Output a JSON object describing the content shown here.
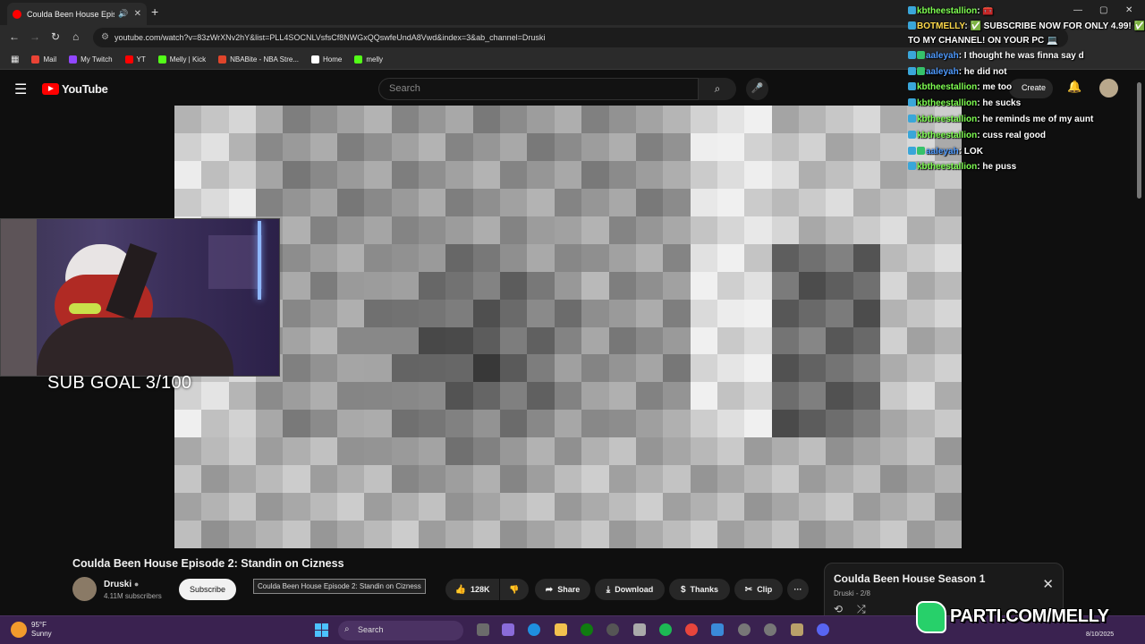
{
  "browser": {
    "tab_title": "Coulda Been House Episo",
    "url": "youtube.com/watch?v=83zWrXNv2hY&list=PLL4SOCNLVsfsCf8NWGxQQswfeUndA8Vwd&index=3&ab_channel=Druski",
    "bookmarks": [
      {
        "label": "Mail",
        "color": "#ea4335"
      },
      {
        "label": "My Twitch",
        "color": "#9146ff"
      },
      {
        "label": "YT",
        "color": "#ff0000"
      },
      {
        "label": "Melly | Kick",
        "color": "#53fc18"
      },
      {
        "label": "NBABite - NBA Stre...",
        "color": "#e0452b"
      },
      {
        "label": "Home",
        "color": "#ffffff"
      },
      {
        "label": "melly",
        "color": "#53fc18"
      }
    ]
  },
  "youtube": {
    "logo": "YouTube",
    "search_placeholder": "Search",
    "create_label": "Create"
  },
  "overlay": {
    "sub_goal": "SUB GOAL 3/100"
  },
  "video": {
    "title": "Coulda Been House Episode 2: Standin on Cizness",
    "tooltip": "Coulda Been House Episode 2: Standin on Cizness",
    "channel": "Druski",
    "subscribers": "4.11M subscribers",
    "subscribe_label": "Subscribe",
    "likes": "128K",
    "share_label": "Share",
    "download_label": "Download",
    "thanks_label": "Thanks",
    "clip_label": "Clip",
    "more_label": "···"
  },
  "playlist": {
    "title": "Coulda Been House Season 1",
    "subtitle": "Druski - 2/8"
  },
  "chat": [
    {
      "user": "kbtheestallion",
      "text": ": 🧰",
      "color": "green"
    },
    {
      "user": "BOTMELLY",
      "text": ": ✅ SUBSCRIBE NOW FOR ONLY 4.99! ✅ TO MY CHANNEL! ON YOUR PC 💻",
      "color": "yellow"
    },
    {
      "user": "aaleyah",
      "text": ": I thought he was finna say d",
      "color": "blue"
    },
    {
      "user": "aaleyah",
      "text": ": he did not",
      "color": "blue"
    },
    {
      "user": "kbtheestallion",
      "text": ": me too",
      "color": "green"
    },
    {
      "user": "kbtheestallion",
      "text": ": he sucks",
      "color": "green"
    },
    {
      "user": "kbtheestallion",
      "text": ": he reminds me of my aunt",
      "color": "green"
    },
    {
      "user": "kbtheestallion",
      "text": ": cuss real good",
      "color": "green"
    },
    {
      "user": "aaleyah",
      "text": ": LOK",
      "color": "blue"
    },
    {
      "user": "kbtheestallion",
      "text": ": he puss",
      "color": "green"
    }
  ],
  "taskbar": {
    "temp": "95°F",
    "condition": "Sunny",
    "search": "Search",
    "date": "8/10/2025"
  },
  "banner": {
    "text": "PARTI.COM/MELLY"
  }
}
